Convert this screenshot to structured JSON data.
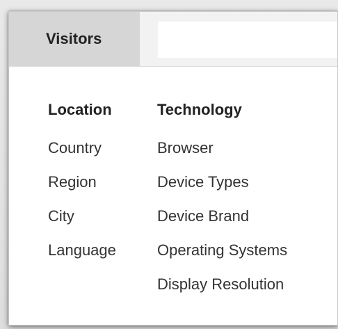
{
  "tab": {
    "label": "Visitors"
  },
  "search": {
    "value": "",
    "placeholder": ""
  },
  "location": {
    "heading": "Location",
    "items": [
      "Country",
      "Region",
      "City",
      "Language"
    ]
  },
  "technology": {
    "heading": "Technology",
    "items": [
      "Browser",
      "Device Types",
      "Device Brand",
      "Operating Systems",
      "Display Resolution"
    ]
  }
}
